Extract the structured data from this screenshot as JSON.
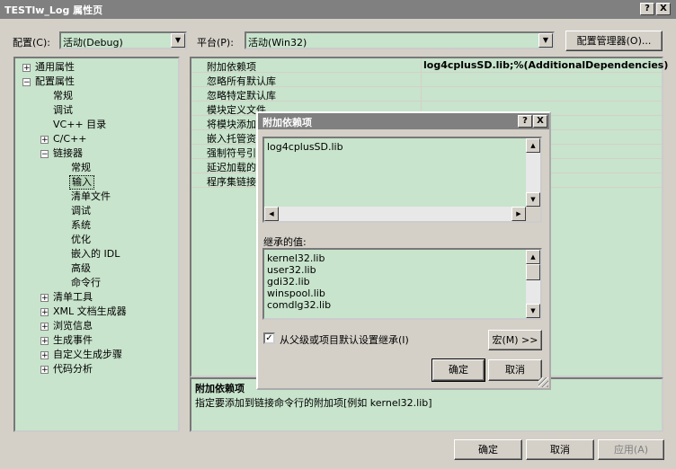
{
  "window": {
    "title": "TESTlw_Log 属性页",
    "help_btn": "?",
    "close_btn": "X"
  },
  "toolbar": {
    "config_label": "配置(C):",
    "config_value": "活动(Debug)",
    "platform_label": "平台(P):",
    "platform_value": "活动(Win32)",
    "config_manager": "配置管理器(O)..."
  },
  "tree": {
    "general": "通用属性",
    "config_props": "配置属性",
    "n_general": "常规",
    "n_debug": "调试",
    "n_vcdirs": "VC++ 目录",
    "n_cc": "C/C++",
    "n_linker": "链接器",
    "l_general": "常规",
    "l_input": "输入",
    "l_manifest": "清单文件",
    "l_debug": "调试",
    "l_system": "系统",
    "l_optimize": "优化",
    "l_idl": "嵌入的 IDL",
    "l_advanced": "高级",
    "l_cmdline": "命令行",
    "n_manifest_tool": "清单工具",
    "n_xmldoc": "XML 文档生成器",
    "n_browse": "浏览信息",
    "n_build_events": "生成事件",
    "n_custom_build": "自定义生成步骤",
    "n_code_analysis": "代码分析"
  },
  "props": {
    "rows": [
      {
        "name": "附加依赖项",
        "value": "log4cplusSD.lib;%(AdditionalDependencies)"
      },
      {
        "name": "忽略所有默认库",
        "value": ""
      },
      {
        "name": "忽略特定默认库",
        "value": ""
      },
      {
        "name": "模块定义文件",
        "value": ""
      },
      {
        "name": "将模块添加",
        "value": ""
      },
      {
        "name": "嵌入托管资",
        "value": ""
      },
      {
        "name": "强制符号引",
        "value": ""
      },
      {
        "name": "延迟加载的",
        "value": ""
      },
      {
        "name": "程序集链接",
        "value": ""
      }
    ]
  },
  "description": {
    "title": "附加依赖项",
    "text": "指定要添加到链接命令行的附加项[例如 kernel32.lib]"
  },
  "dialog": {
    "title": "附加依赖项",
    "help_btn": "?",
    "close_btn": "X",
    "entry": "log4cplusSD.lib",
    "inherited_label": "继承的值:",
    "inherited": [
      "kernel32.lib",
      "user32.lib",
      "gdi32.lib",
      "winspool.lib",
      "comdlg32.lib"
    ],
    "inherit_checkbox": "从父级或项目默认设置继承(I)",
    "inherit_checked": true,
    "macros_btn": "宏(M) >>",
    "ok_btn": "确定",
    "cancel_btn": "取消"
  },
  "footer": {
    "ok": "确定",
    "cancel": "取消",
    "apply": "应用(A)"
  }
}
